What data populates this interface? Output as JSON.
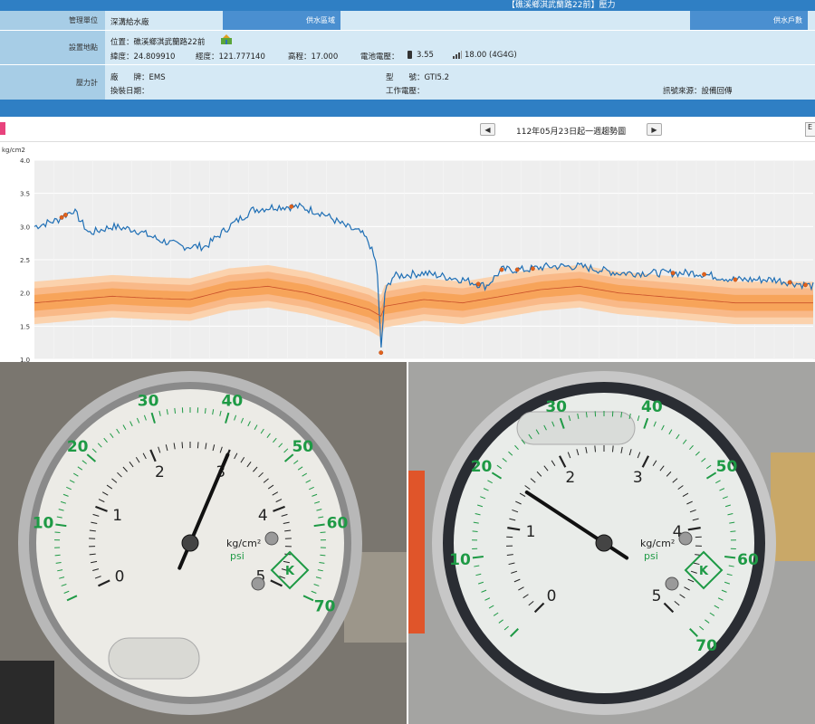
{
  "header": {
    "title": "【礁溪鄉淇武蘭路22前】壓力"
  },
  "info": {
    "mgmt_label": "管理單位",
    "mgmt_value": "深溝給水廠",
    "supply_area_label": "供水區域",
    "supply_households_label": "供水戶數",
    "site_label": "設置地點",
    "location": "位置：礁溪鄉淇武蘭路22前",
    "latitude": "緯度：24.809910",
    "longitude": "經度：121.777140",
    "elevation": "高程：17.000",
    "battery_label": "電池電壓：",
    "battery_value": "3.55",
    "signal_value": "18.00 (4G4G)",
    "meter_label": "壓力計",
    "brand": "廠　　牌：EMS",
    "model": "型　　號：GTI5.2",
    "install_date": "換裝日期：",
    "work_voltage": "工作電壓：",
    "signal_source": "訊號來源：設備回傳"
  },
  "nav": {
    "prev": "◀",
    "next": "▶",
    "title": "112年05月23日起一週趨勢圖",
    "right_btn": "E"
  },
  "chart_data": {
    "type": "line",
    "ylabel": "kg/cm2",
    "ylim": [
      1.0,
      4.0
    ],
    "yticks": [
      "4.0",
      "3.5",
      "3.0",
      "2.5",
      "2.0",
      "1.5",
      "1.0"
    ],
    "grid": true,
    "series": [
      {
        "color": "#1f6fb5",
        "x": [
          0,
          0.03,
          0.05,
          0.07,
          0.1,
          0.13,
          0.16,
          0.19,
          0.22,
          0.25,
          0.28,
          0.31,
          0.34,
          0.37,
          0.4,
          0.42,
          0.43,
          0.44,
          0.445,
          0.45,
          0.46,
          0.5,
          0.55,
          0.58,
          0.6,
          0.63,
          0.66,
          0.7,
          0.75,
          0.8,
          0.85,
          0.9,
          0.95,
          1.0
        ],
        "y": [
          3.0,
          3.1,
          3.25,
          2.9,
          3.0,
          2.95,
          2.8,
          2.7,
          2.7,
          3.0,
          3.25,
          3.3,
          3.3,
          3.2,
          3.0,
          2.9,
          2.75,
          2.4,
          1.1,
          2.0,
          2.25,
          2.3,
          2.2,
          2.1,
          2.35,
          2.35,
          2.4,
          2.4,
          2.3,
          2.3,
          2.3,
          2.2,
          2.2,
          2.1
        ]
      },
      {
        "color": "#c9502a",
        "x": [
          0,
          0.05,
          0.1,
          0.15,
          0.2,
          0.25,
          0.3,
          0.35,
          0.4,
          0.43,
          0.445,
          0.45,
          0.5,
          0.55,
          0.6,
          0.65,
          0.7,
          0.75,
          0.8,
          0.85,
          0.9,
          0.95,
          1.0
        ],
        "y": [
          1.85,
          1.9,
          1.95,
          1.92,
          1.9,
          2.05,
          2.1,
          2.0,
          1.85,
          1.75,
          1.65,
          1.8,
          1.9,
          1.85,
          1.95,
          2.05,
          2.1,
          2.0,
          1.95,
          1.9,
          1.85,
          1.85,
          1.85
        ]
      }
    ]
  },
  "gauges": [
    {
      "outer_ticks": [
        "10",
        "20",
        "30",
        "40",
        "50",
        "60",
        "70"
      ],
      "inner_ticks": [
        "0",
        "1",
        "2",
        "3",
        "4",
        "5"
      ],
      "unit": "kg/cm²",
      "unit2": "psi",
      "brand": "K",
      "reading": 3.0
    },
    {
      "outer_ticks": [
        "10",
        "20",
        "30",
        "40",
        "50",
        "60",
        "70"
      ],
      "inner_ticks": [
        "0",
        "1",
        "2",
        "3",
        "4",
        "5"
      ],
      "unit": "kg/cm²",
      "unit2": "psi",
      "brand": "K",
      "reading": 1.45
    }
  ],
  "colors": {
    "header_blue": "#2f7fc4",
    "info_bg": "#d5e9f5",
    "label_bg": "#a7cde6",
    "line_blue": "#1f6fb5",
    "band_orange": "#f7a45a",
    "gauge_green": "#1e9a45"
  }
}
